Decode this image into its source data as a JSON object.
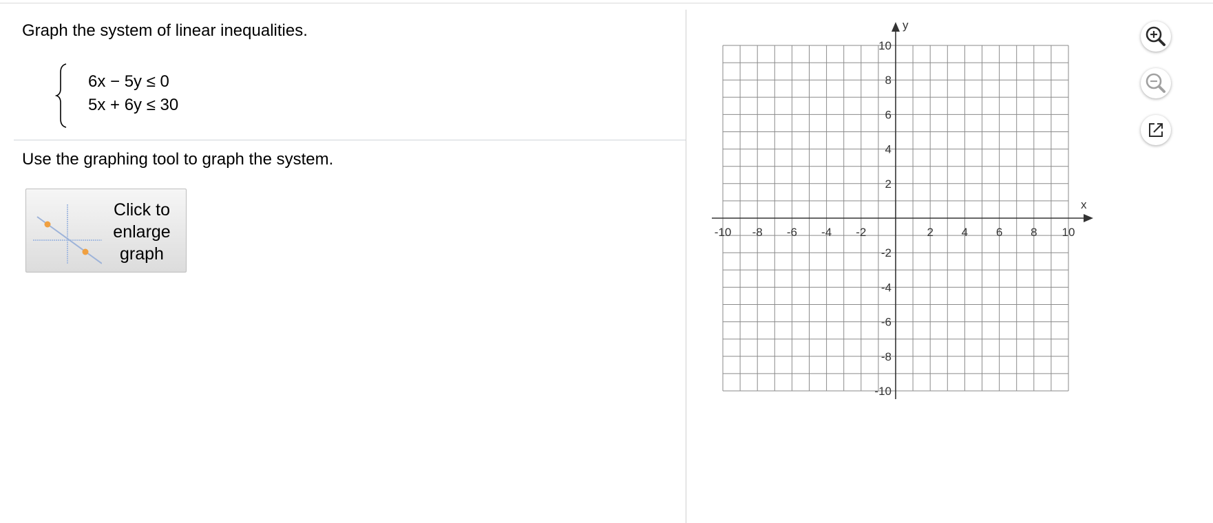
{
  "question": {
    "prompt": "Graph the system of linear inequalities.",
    "inequalities": [
      "6x − 5y ≤ 0",
      "5x + 6y ≤ 30"
    ]
  },
  "instruction": "Use the graphing tool to graph the system.",
  "enlarge_button": {
    "label_lines": [
      "Click to",
      "enlarge",
      "graph"
    ],
    "icon": "graph-thumbnail-icon"
  },
  "graph_tools": {
    "zoom_in_icon": "zoom-in-icon",
    "zoom_out_icon": "zoom-out-icon",
    "popout_icon": "external-link-icon"
  },
  "chart_data": {
    "type": "coordinate-grid",
    "xlabel": "x",
    "ylabel": "y",
    "xlim": [
      -10,
      10
    ],
    "ylim": [
      -10,
      10
    ],
    "grid": true,
    "grid_step": 1,
    "x_tick_labels": [
      "-10",
      "-8",
      "-6",
      "-4",
      "-2",
      "2",
      "4",
      "6",
      "8",
      "10"
    ],
    "x_tick_values": [
      -10,
      -8,
      -6,
      -4,
      -2,
      2,
      4,
      6,
      8,
      10
    ],
    "y_tick_labels": [
      "10",
      "8",
      "6",
      "4",
      "2",
      "-2",
      "-4",
      "-6",
      "-8",
      "-10"
    ],
    "y_tick_values": [
      10,
      8,
      6,
      4,
      2,
      -2,
      -4,
      -6,
      -8,
      -10
    ]
  },
  "colors": {
    "grid_line": "#8a8a8a",
    "axis": "#333333",
    "thumb_line": "#9db3d9",
    "thumb_point": "#f0a040",
    "tool_icon": "#2b2b2b",
    "tool_icon_disabled": "#a0a0a0"
  }
}
